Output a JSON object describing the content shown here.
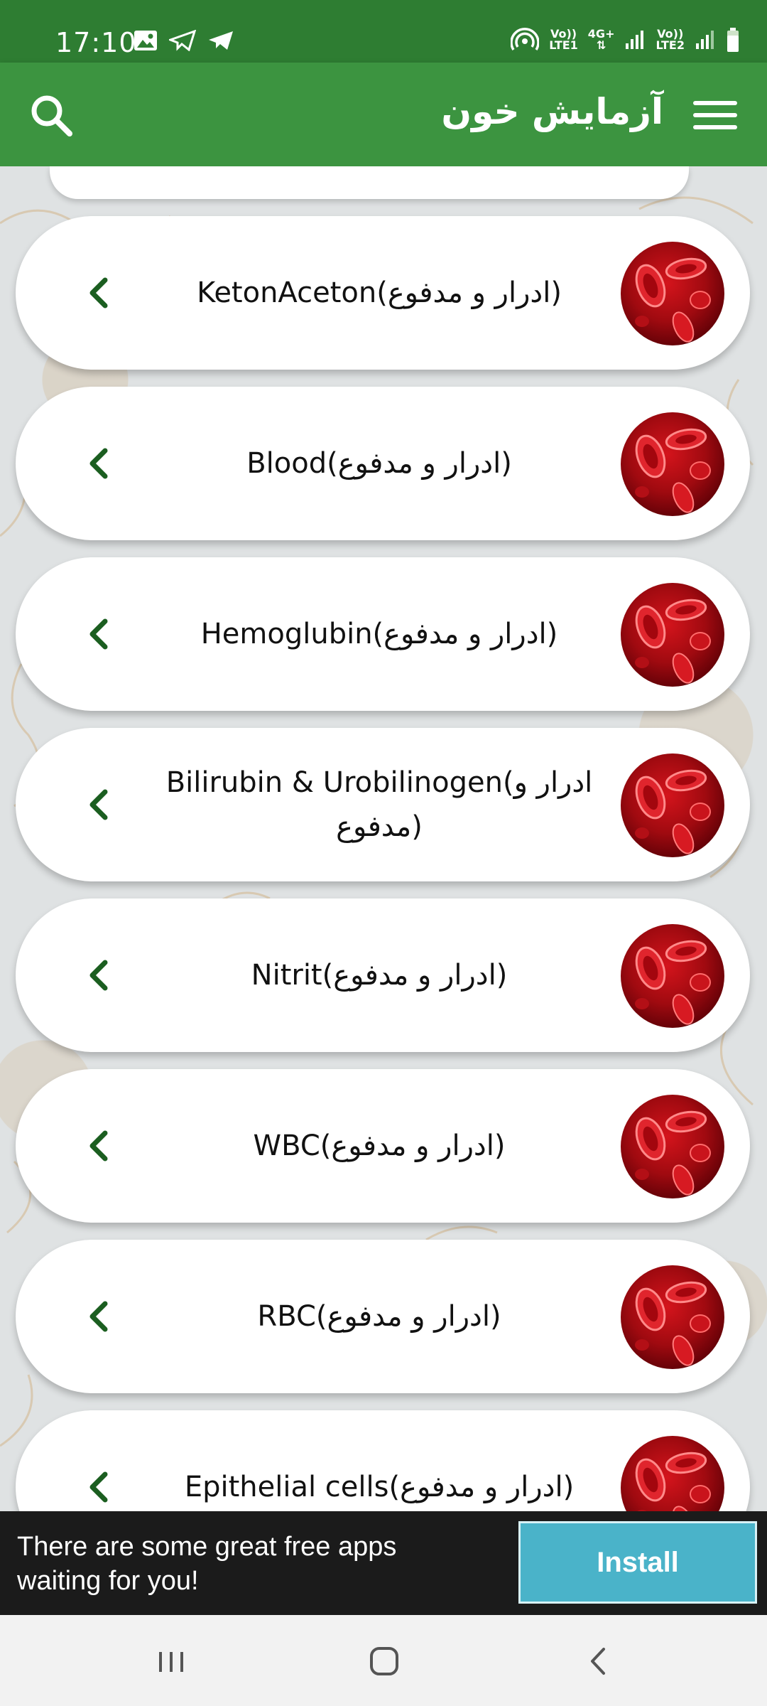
{
  "status_bar": {
    "time": "17:10",
    "left_icons": [
      "image-icon",
      "telegram-outline-icon",
      "telegram-icon"
    ],
    "right_icons": [
      "hotspot-icon",
      "volte-lte1-icon",
      "4g-data-icon",
      "signal-1-icon",
      "volte-lte2-icon",
      "signal-2-icon",
      "battery-icon"
    ],
    "sim1_top": "Vo))",
    "sim1_bottom": "LTE1",
    "net_type": "4G+",
    "sim2_top": "Vo))",
    "sim2_bottom": "LTE2"
  },
  "app_bar": {
    "title": "آزمایش خون",
    "search_icon": "search-icon",
    "menu_icon": "hamburger-menu-icon",
    "color": "#3c9440"
  },
  "list": {
    "items": [
      {
        "label": "KetonAceton(ادرار و مدفوع)"
      },
      {
        "label": "Blood(ادرار و مدفوع)"
      },
      {
        "label": "Hemoglubin(ادرار و مدفوع)"
      },
      {
        "label": "Bilirubin & Urobilinogen(ادرار و مدفوع)"
      },
      {
        "label": "Nitrit(ادرار و مدفوع)"
      },
      {
        "label": "WBC(ادرار و مدفوع)"
      },
      {
        "label": "RBC(ادرار و مدفوع)"
      },
      {
        "label": "Epithelial cells(ادرار و مدفوع)"
      }
    ],
    "item_icon": "red-blood-cells-icon",
    "chevron_icon": "chevron-left-icon",
    "chevron_color": "#1b5e20"
  },
  "ad": {
    "text": "There are some great free apps waiting for you!",
    "button_label": "Install",
    "button_color": "#4ab3c9"
  },
  "nav_bar": {
    "buttons": [
      "recent-apps-icon",
      "home-icon",
      "back-icon"
    ]
  }
}
